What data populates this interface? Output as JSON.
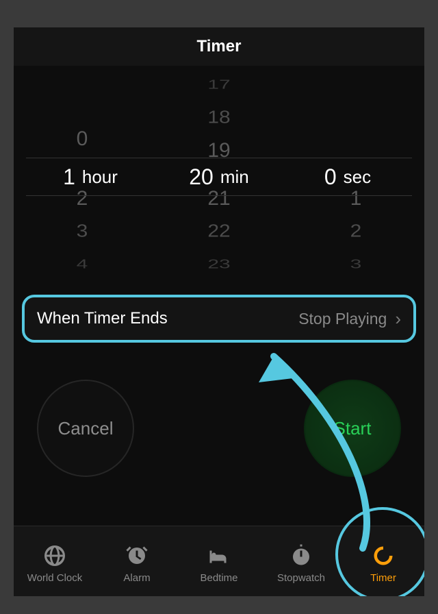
{
  "header": {
    "title": "Timer"
  },
  "picker": {
    "hours": {
      "selected": "1",
      "unit": "hour",
      "above": [
        "0"
      ],
      "below": [
        "2",
        "3",
        "4"
      ]
    },
    "minutes": {
      "selected": "20",
      "unit": "min",
      "above": [
        "17",
        "18",
        "19"
      ],
      "below": [
        "21",
        "22",
        "23"
      ]
    },
    "seconds": {
      "selected": "0",
      "unit": "sec",
      "above": [],
      "below": [
        "1",
        "2",
        "3"
      ]
    }
  },
  "ends_row": {
    "label": "When Timer Ends",
    "value": "Stop Playing"
  },
  "buttons": {
    "cancel": "Cancel",
    "start": "Start"
  },
  "tabs": {
    "world_clock": "World Clock",
    "alarm": "Alarm",
    "bedtime": "Bedtime",
    "stopwatch": "Stopwatch",
    "timer": "Timer"
  },
  "annotation": {
    "highlight": "timer-tab-and-ends-row"
  }
}
